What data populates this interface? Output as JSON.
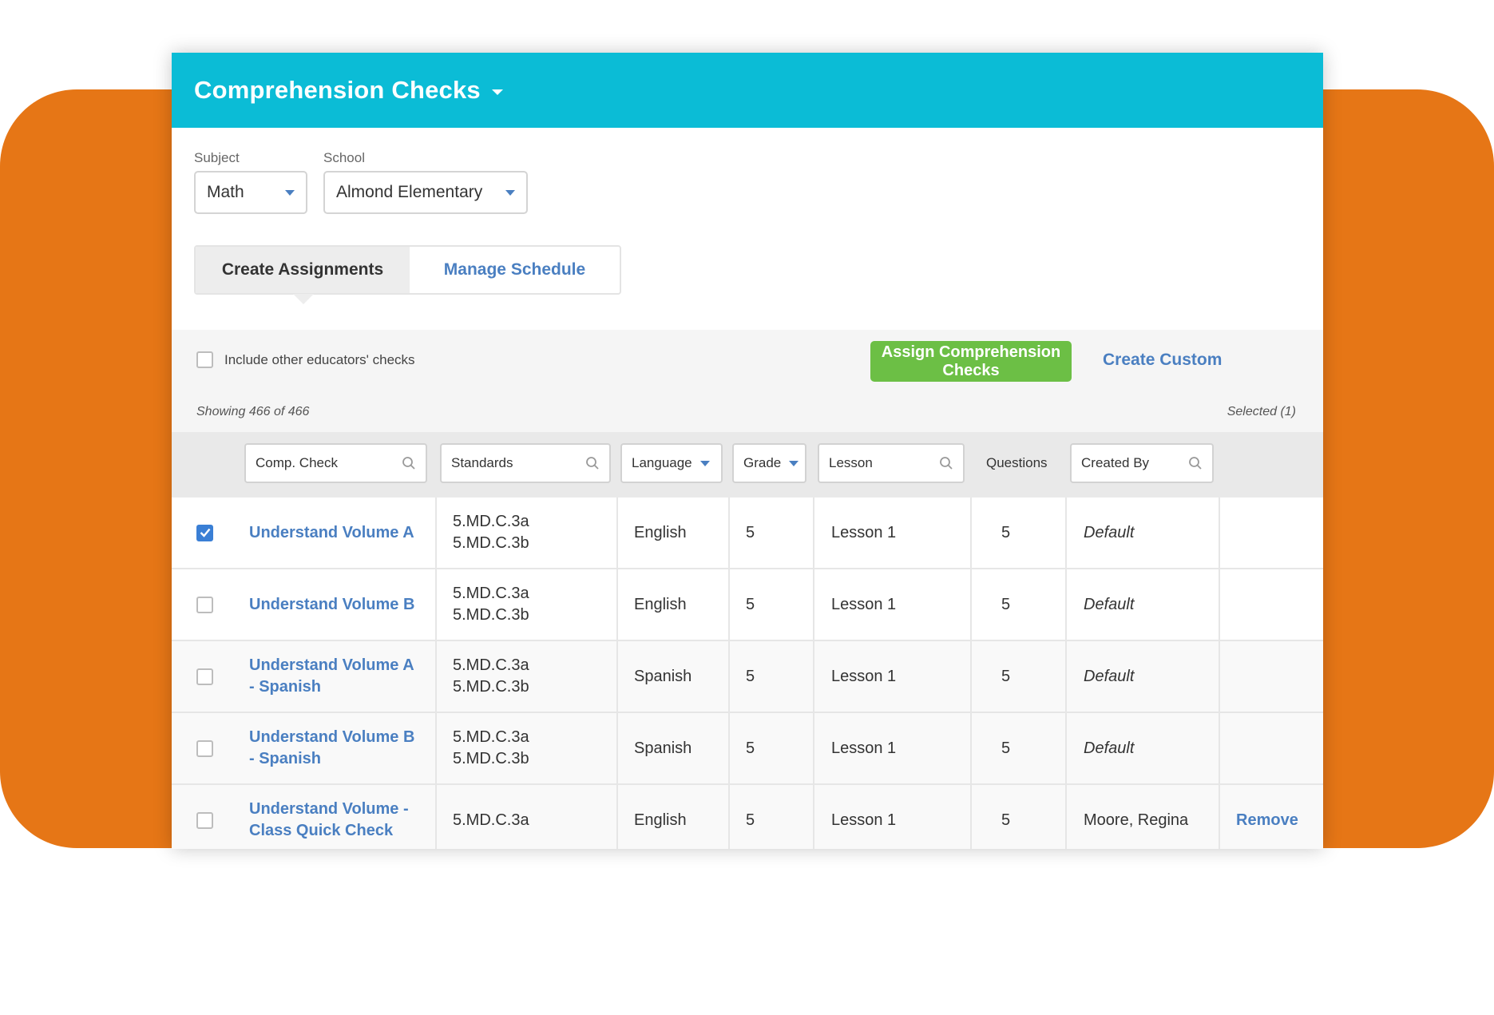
{
  "header": {
    "title": "Comprehension Checks"
  },
  "filters": {
    "subject_label": "Subject",
    "subject_value": "Math",
    "school_label": "School",
    "school_value": "Almond Elementary"
  },
  "tabs": [
    {
      "label": "Create Assignments",
      "active": true
    },
    {
      "label": "Manage Schedule",
      "active": false
    }
  ],
  "toolbar": {
    "include_label": "Include other educators' checks",
    "assign_label": "Assign Comprehension Checks",
    "create_custom_label": "Create Custom",
    "showing_text": "Showing 466 of 466",
    "selected_text": "Selected (1)"
  },
  "columns": {
    "comp_check": "Comp. Check",
    "standards": "Standards",
    "language": "Language",
    "grade": "Grade",
    "lesson": "Lesson",
    "questions": "Questions",
    "created_by": "Created By"
  },
  "rows": [
    {
      "checked": true,
      "title": [
        "Understand Volume A"
      ],
      "standards": [
        "5.MD.C.3a",
        "5.MD.C.3b"
      ],
      "language": "English",
      "grade": "5",
      "lesson": "Lesson 1",
      "questions": "5",
      "created_by": "Default",
      "action": ""
    },
    {
      "checked": false,
      "title": [
        "Understand Volume B"
      ],
      "standards": [
        "5.MD.C.3a",
        "5.MD.C.3b"
      ],
      "language": "English",
      "grade": "5",
      "lesson": "Lesson 1",
      "questions": "5",
      "created_by": "Default",
      "action": ""
    },
    {
      "checked": false,
      "title": [
        "Understand Volume A",
        "- Spanish"
      ],
      "standards": [
        "5.MD.C.3a",
        "5.MD.C.3b"
      ],
      "language": "Spanish",
      "grade": "5",
      "lesson": "Lesson 1",
      "questions": "5",
      "created_by": "Default",
      "action": ""
    },
    {
      "checked": false,
      "title": [
        "Understand Volume B",
        "- Spanish"
      ],
      "standards": [
        "5.MD.C.3a",
        "5.MD.C.3b"
      ],
      "language": "Spanish",
      "grade": "5",
      "lesson": "Lesson 1",
      "questions": "5",
      "created_by": "Default",
      "action": ""
    },
    {
      "checked": false,
      "title": [
        "Understand Volume -",
        "Class Quick Check"
      ],
      "standards": [
        "5.MD.C.3a"
      ],
      "language": "English",
      "grade": "5",
      "lesson": "Lesson 1",
      "questions": "5",
      "created_by": "Moore, Regina",
      "action": "Remove"
    }
  ],
  "colors": {
    "header_bg": "#0bbcd6",
    "accent_link": "#4a7fc1",
    "primary_button": "#6cbf45",
    "backdrop": "#e67616"
  }
}
